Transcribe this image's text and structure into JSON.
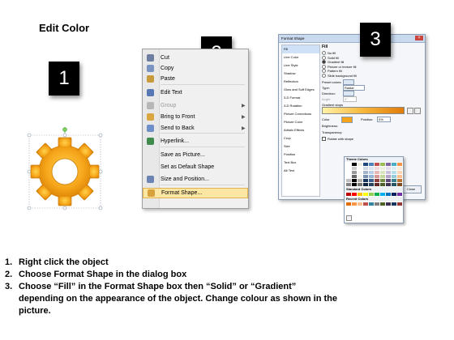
{
  "title": "Edit Color",
  "badges": {
    "one": "1",
    "two": "2",
    "three": "3"
  },
  "context_menu": {
    "items": [
      {
        "label": "Cut",
        "icon": "scissors-icon",
        "color": "#6d7ea0",
        "disabled": false,
        "submenu": false
      },
      {
        "label": "Copy",
        "icon": "copy-icon",
        "color": "#7a93c2",
        "disabled": false,
        "submenu": false
      },
      {
        "label": "Paste",
        "icon": "paste-icon",
        "color": "#c89b3c",
        "disabled": false,
        "submenu": false
      },
      {
        "label": "Edit Text",
        "icon": "edit-text-icon",
        "color": "#5877b5",
        "disabled": false,
        "submenu": false
      },
      {
        "label": "Group",
        "icon": "group-icon",
        "color": "#b7b7b7",
        "disabled": true,
        "submenu": true
      },
      {
        "label": "Bring to Front",
        "icon": "bring-front-icon",
        "color": "#d9a640",
        "disabled": false,
        "submenu": true
      },
      {
        "label": "Send to Back",
        "icon": "send-back-icon",
        "color": "#6f8fc9",
        "disabled": false,
        "submenu": true
      },
      {
        "label": "Hyperlink...",
        "icon": "globe-link-icon",
        "color": "#3f8a4c",
        "disabled": false,
        "submenu": false
      },
      {
        "label": "Save as Picture...",
        "icon": "",
        "color": "",
        "disabled": false,
        "submenu": false
      },
      {
        "label": "Set as Default Shape",
        "icon": "",
        "color": "",
        "disabled": false,
        "submenu": false
      },
      {
        "label": "Size and Position...",
        "icon": "size-position-icon",
        "color": "#6b84b3",
        "disabled": false,
        "submenu": false
      },
      {
        "label": "Format Shape...",
        "icon": "format-shape-icon",
        "color": "#d7a23b",
        "disabled": false,
        "submenu": false,
        "highlighted": true
      }
    ]
  },
  "format_dialog": {
    "title": "Format Shape",
    "categories": [
      "Fill",
      "Line Color",
      "Line Style",
      "Shadow",
      "Reflection",
      "Glow and Soft Edges",
      "3-D Format",
      "3-D Rotation",
      "Picture Corrections",
      "Picture Color",
      "Artistic Effects",
      "Crop",
      "Size",
      "Position",
      "Text Box",
      "Alt Text"
    ],
    "section_heading": "Fill",
    "fill_options": [
      "No fill",
      "Solid fill",
      "Gradient fill",
      "Picture or texture fill",
      "Pattern fill",
      "Slide background fill"
    ],
    "selected_fill_index": 2,
    "preset_label": "Preset colors:",
    "type_label": "Type:",
    "type_value": "Radial",
    "direction_label": "Direction:",
    "angle_label": "Angle:",
    "angle_value": "0°",
    "gradient_stops_label": "Gradient stops",
    "color_label": "Color",
    "position_label": "Position:",
    "position_value": "0%",
    "brightness_label": "Brightness:",
    "transparency_label": "Transparency:",
    "rotate_label": "Rotate with shape",
    "close_label": "Close"
  },
  "color_palette": {
    "theme_label": "Theme Colors",
    "standard_label": "Standard Colors",
    "recent_label": "Recent Colors",
    "theme_top": [
      "#ffffff",
      "#000000",
      "#eeece1",
      "#1f497d",
      "#4f81bd",
      "#c0504d",
      "#9bbb59",
      "#8064a2",
      "#4bacc6",
      "#f79646"
    ],
    "standard": [
      "#c00000",
      "#ff0000",
      "#ffc000",
      "#ffff00",
      "#92d050",
      "#00b050",
      "#00b0f0",
      "#0070c0",
      "#002060",
      "#7030a0"
    ],
    "recent": [
      "#e46c0a",
      "#f79646",
      "#fac08f",
      "#c0504d",
      "#31859c",
      "#7f7f7f",
      "#4f6228",
      "#3f3151",
      "#17375e",
      "#943634"
    ]
  },
  "steps": [
    {
      "num": "1.",
      "text": "Right click the object"
    },
    {
      "num": "2.",
      "text": "Choose Format Shape in the dialog box"
    },
    {
      "num": "3.",
      "text": "Choose “Fill” in the Format Shape box then “Solid” or “Gradient” depending on the appearance of the object. Change colour as shown in the picture."
    }
  ]
}
